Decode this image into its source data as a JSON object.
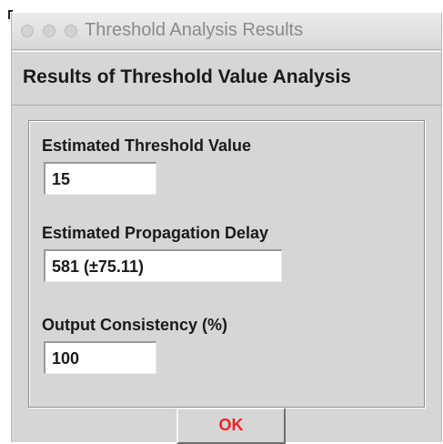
{
  "window": {
    "title": "Threshold Analysis Results",
    "heading": "Results of Threshold Value Analysis"
  },
  "fields": [
    {
      "label": "Estimated Threshold Value",
      "value": "15"
    },
    {
      "label": "Estimated Propagation Delay",
      "value": "581 (±75.11)"
    },
    {
      "label": "Output Consistency (%)",
      "value": "100"
    }
  ],
  "buttons": {
    "ok_label": "OK"
  },
  "colors": {
    "ok_text": "#e8262b",
    "window_bg": "#d6d6d6"
  },
  "icons": {
    "title_controls": [
      "close-light-icon",
      "minimize-light-icon",
      "zoom-light-icon"
    ]
  }
}
